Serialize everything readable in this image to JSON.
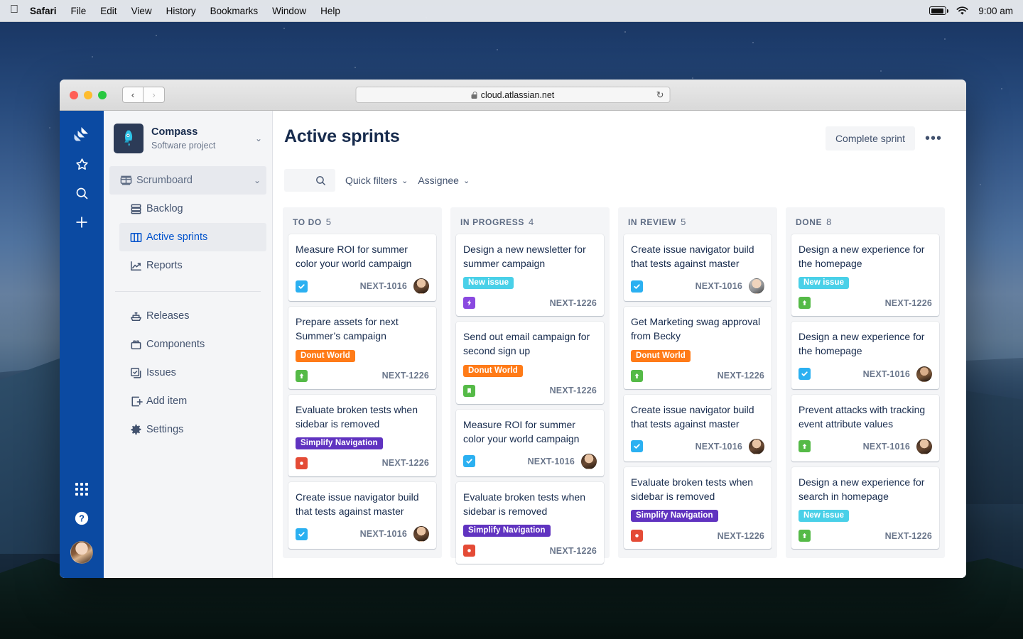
{
  "menubar": {
    "apple_icon": "apple-icon",
    "items": [
      {
        "label": "Safari",
        "bold": true
      },
      {
        "label": "File",
        "bold": false
      },
      {
        "label": "Edit",
        "bold": false
      },
      {
        "label": "View",
        "bold": false
      },
      {
        "label": "History",
        "bold": false
      },
      {
        "label": "Bookmarks",
        "bold": false
      },
      {
        "label": "Window",
        "bold": false
      },
      {
        "label": "Help",
        "bold": false
      }
    ],
    "battery_icon": "battery-icon",
    "wifi_icon": "wifi-icon",
    "time": "9:00 am"
  },
  "browser": {
    "back_glyph": "‹",
    "forward_glyph": "›",
    "url": "cloud.atlassian.net",
    "lock_icon": "lock-icon",
    "reload_glyph": "↻"
  },
  "rail": {
    "items": [
      {
        "name": "jira-logo-icon",
        "label": "Jira"
      },
      {
        "name": "star-icon",
        "label": "Starred"
      },
      {
        "name": "search-icon",
        "label": "Search"
      },
      {
        "name": "plus-icon",
        "label": "Create"
      }
    ],
    "bottom": [
      {
        "name": "app-switcher-icon",
        "label": "App switcher"
      },
      {
        "name": "help-icon",
        "label": "Help"
      },
      {
        "name": "profile-avatar",
        "label": "Your profile"
      }
    ]
  },
  "sidebar": {
    "project": {
      "name": "Compass",
      "type": "Software project",
      "avatar_icon": "rocket-icon",
      "chevron": "⌄"
    },
    "board": {
      "label": "Scrumboard",
      "icon": "board-icon",
      "chevron": "⌄"
    },
    "items": [
      {
        "label": "Backlog",
        "icon": "backlog-icon",
        "selected": false
      },
      {
        "label": "Active sprints",
        "icon": "columns-icon",
        "selected": true
      },
      {
        "label": "Reports",
        "icon": "reports-icon",
        "selected": false
      }
    ],
    "items2": [
      {
        "label": "Releases",
        "icon": "ship-icon"
      },
      {
        "label": "Components",
        "icon": "components-icon"
      },
      {
        "label": "Issues",
        "icon": "issues-icon"
      },
      {
        "label": "Add item",
        "icon": "add-item-icon"
      },
      {
        "label": "Settings",
        "icon": "gear-icon"
      }
    ]
  },
  "header": {
    "title": "Active sprints",
    "complete_sprint_label": "Complete sprint",
    "more_glyph": "•••"
  },
  "filters": {
    "search_icon": "search-icon",
    "search_value": "",
    "search_placeholder": "",
    "quick_filters_label": "Quick filters",
    "assignee_label": "Assignee",
    "chevron": "⌄"
  },
  "colors": {
    "jira_blue": "#0b4aa2",
    "link_blue": "#0052cc",
    "label_orange": "#ff7b18",
    "label_purple": "#6033c0",
    "label_cyan": "#49d0e8",
    "type_task_blue": "#2bb0f1",
    "type_story_green": "#55ba47",
    "type_bug_red": "#e44b36",
    "type_epic_purple": "#8a49e0",
    "column_bg": "#f4f5f7"
  },
  "board": {
    "columns": [
      {
        "name": "TO DO",
        "count": "5",
        "cards": [
          {
            "title": "Measure ROI for summer color your world campaign",
            "label": null,
            "label_color": null,
            "type": "task",
            "key": "NEXT-1016",
            "avatar": "beard"
          },
          {
            "title": "Prepare assets for next Summer’s campaign",
            "label": "Donut World",
            "label_color": "orange",
            "type": "story",
            "key": "NEXT-1226",
            "avatar": null
          },
          {
            "title": "Evaluate broken tests when sidebar is removed",
            "label": "Simplify Navigation",
            "label_color": "purple",
            "type": "bug",
            "key": "NEXT-1226",
            "avatar": null
          },
          {
            "title": "Create issue navigator build that tests against master",
            "label": null,
            "label_color": null,
            "type": "task",
            "key": "NEXT-1016",
            "avatar": "beard"
          }
        ]
      },
      {
        "name": "IN PROGRESS",
        "count": "4",
        "cards": [
          {
            "title": "Design a new newsletter for summer campaign",
            "label": "New issue",
            "label_color": "cyan",
            "type": "epic",
            "key": "NEXT-1226",
            "avatar": null
          },
          {
            "title": "Send out email campaign for second sign up",
            "label": "Donut World",
            "label_color": "orange",
            "type": "bookmark",
            "key": "NEXT-1226",
            "avatar": null
          },
          {
            "title": "Measure ROI for summer color your world campaign",
            "label": null,
            "label_color": null,
            "type": "task",
            "key": "NEXT-1016",
            "avatar": "beard"
          },
          {
            "title": "Evaluate broken tests when sidebar is removed",
            "label": "Simplify Navigation",
            "label_color": "purple",
            "type": "bug",
            "key": "NEXT-1226",
            "avatar": null
          }
        ]
      },
      {
        "name": "IN REVIEW",
        "count": "5",
        "cards": [
          {
            "title": "Create issue navigator build that tests against master",
            "label": null,
            "label_color": null,
            "type": "task",
            "key": "NEXT-1016",
            "avatar": "pale"
          },
          {
            "title": "Get Marketing swag approval from Becky",
            "label": "Donut World",
            "label_color": "orange",
            "type": "story",
            "key": "NEXT-1226",
            "avatar": null
          },
          {
            "title": "Create issue navigator build that tests against master",
            "label": null,
            "label_color": null,
            "type": "task",
            "key": "NEXT-1016",
            "avatar": "beard"
          },
          {
            "title": "Evaluate broken tests when sidebar is removed",
            "label": "Simplify Navigation",
            "label_color": "purple",
            "type": "bug",
            "key": "NEXT-1226",
            "avatar": null
          }
        ]
      },
      {
        "name": "DONE",
        "count": "8",
        "cards": [
          {
            "title": "Design a new experience for the homepage",
            "label": "New issue",
            "label_color": "cyan",
            "type": "story",
            "key": "NEXT-1226",
            "avatar": null
          },
          {
            "title": "Design a new experience for the homepage",
            "label": null,
            "label_color": null,
            "type": "task",
            "key": "NEXT-1016",
            "avatar": "dark"
          },
          {
            "title": "Prevent attacks with tracking event attribute values",
            "label": null,
            "label_color": null,
            "type": "story",
            "key": "NEXT-1016",
            "avatar": "beard"
          },
          {
            "title": "Design a new experience for search in homepage",
            "label": "New issue",
            "label_color": "cyan",
            "type": "story",
            "key": "NEXT-1226",
            "avatar": null
          }
        ]
      }
    ]
  }
}
